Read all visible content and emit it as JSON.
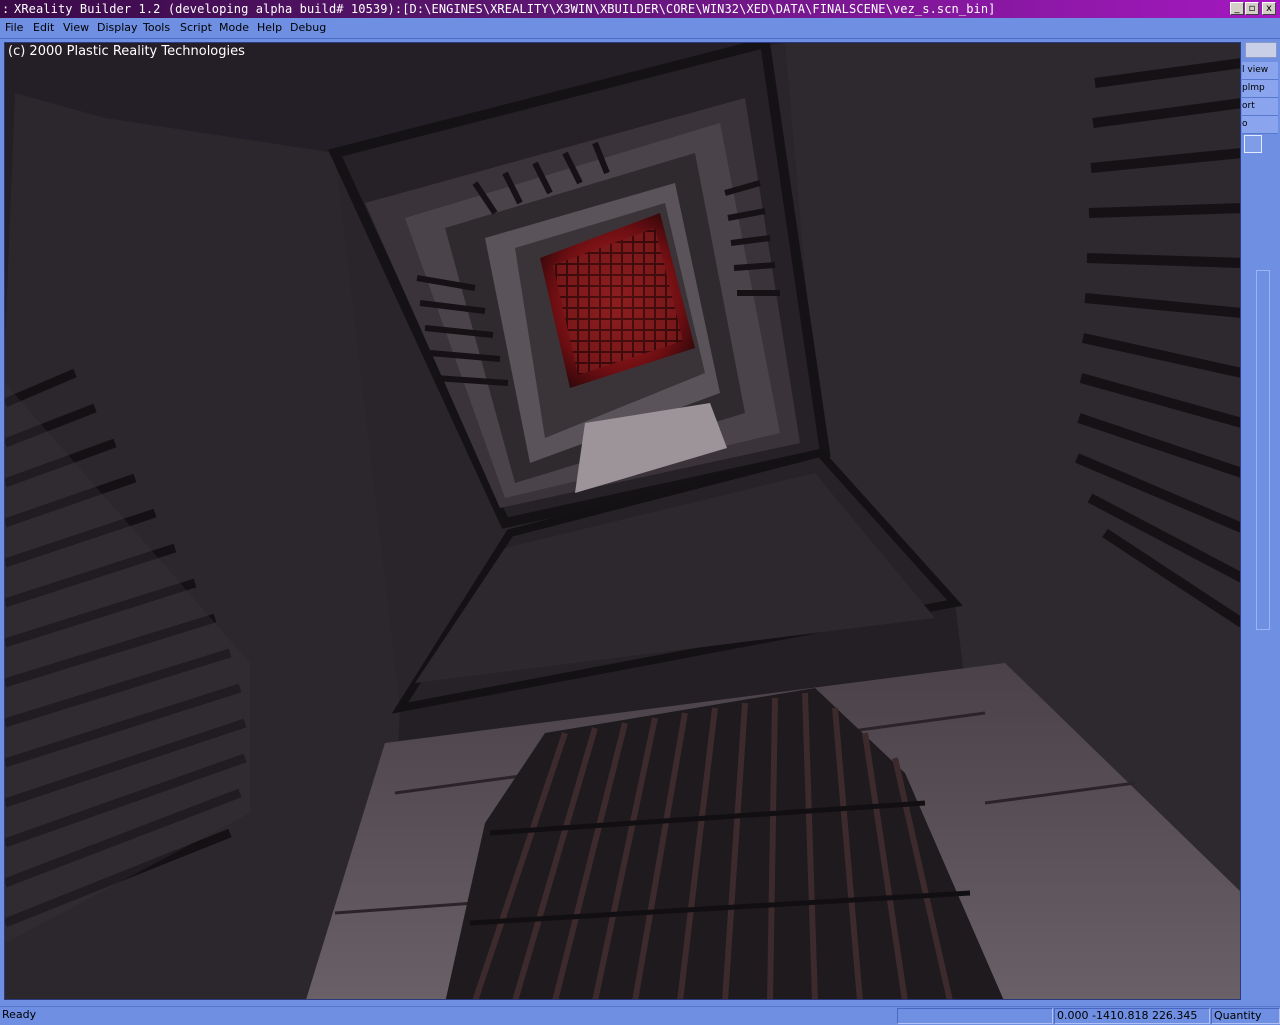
{
  "window": {
    "title": "XReality Builder 1.2 (developing alpha build# 10539):[D:\\ENGINES\\XREALITY\\X3WIN\\XBUILDER\\CORE\\WIN32\\XED\\DATA\\FINALSCENE\\vez_s.scn_bin]",
    "app_icon": "app-icon",
    "controls": {
      "minimize": "_",
      "maximize": "▫",
      "close": "x"
    }
  },
  "menu": [
    "File",
    "Edit",
    "View",
    "Display",
    "Tools",
    "Script",
    "Mode",
    "Help",
    "Debug"
  ],
  "viewport": {
    "copyright": "(c) 2000 Plastic Reality Technologies"
  },
  "side_panel": {
    "tabs": [
      "l view",
      "plmp",
      "ort",
      "o"
    ]
  },
  "status_bar": {
    "status": "Ready",
    "blank": "",
    "coords": "0.000 -1410.818 226.345",
    "quantity": "Quantity"
  },
  "colors": {
    "title_gradient_start": "#3a0a48",
    "title_gradient_end": "#a418c0",
    "chrome": "#6f8fe3",
    "light_red": "#b01a1a"
  }
}
